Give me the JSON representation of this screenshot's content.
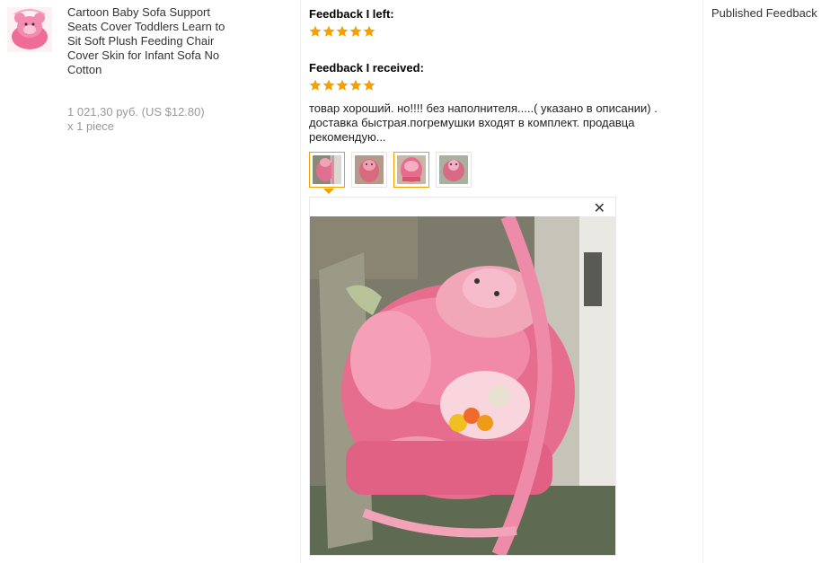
{
  "product": {
    "title": "Cartoon Baby Sofa Support Seats Cover Toddlers Learn to Sit Soft Plush Feeding Chair Cover Skin for Infant Sofa No Cotton",
    "price": "1 021,30 руб. (US $12.80)",
    "quantity": "x 1 piece",
    "thumbnail_icon": "pink-plush-sofa-image"
  },
  "feedback_left": {
    "label": "Feedback I left:",
    "stars": 5
  },
  "feedback_received": {
    "label": "Feedback I received:",
    "stars": 5,
    "text": "товар хороший. но!!!! без наполнителя.....( указано в описании) . доставка быстрая.погремушки входят в комплект. продавца рекомендую..."
  },
  "photos": {
    "selected_index": 0,
    "count": 4
  },
  "viewer": {
    "close_icon": "close-icon"
  },
  "published_label": "Published Feedback",
  "colors": {
    "star": "#f5a000",
    "active_border": "#f0a000",
    "muted_text": "#999999"
  }
}
